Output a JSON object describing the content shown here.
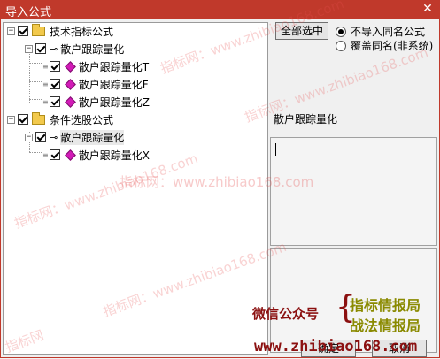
{
  "window": {
    "title": "导入公式",
    "close_glyph": "✕"
  },
  "tree": {
    "nodes": [
      {
        "label": "技术指标公式",
        "expander": "−"
      },
      {
        "label": "散户跟踪量化",
        "expander": "−",
        "prefix": "⊸"
      },
      {
        "label": "散户跟踪量化T",
        "prefix": "≡"
      },
      {
        "label": "散户跟踪量化F",
        "prefix": "≡"
      },
      {
        "label": "散户跟踪量化Z",
        "prefix": "≡"
      },
      {
        "label": "条件选股公式",
        "expander": "−"
      },
      {
        "label": "散户跟踪量化",
        "expander": "−",
        "prefix": "⊸"
      },
      {
        "label": "散户跟踪量化X",
        "prefix": "≡"
      }
    ]
  },
  "right_panel": {
    "select_all_button": "全部选中",
    "radio_no_import": "不导入同名公式",
    "radio_overwrite": "覆盖同名(非系统)",
    "formula_name": "散户跟踪量化"
  },
  "buttons": {
    "ok": "确定",
    "cancel": "取消"
  },
  "watermark": {
    "text": "指标网：www.zhibiao168.com",
    "short": "指标网"
  },
  "promo": {
    "wechat": "微信公众号",
    "line1": "指标情报局",
    "line2": "战法情报局",
    "site": "www.zhibiao168.com"
  },
  "colors": {
    "titlebar": "#c0392b",
    "indicator_icon": "#d21bb7",
    "promo_red": "#8b1010",
    "promo_olive": "#8a8a00"
  }
}
